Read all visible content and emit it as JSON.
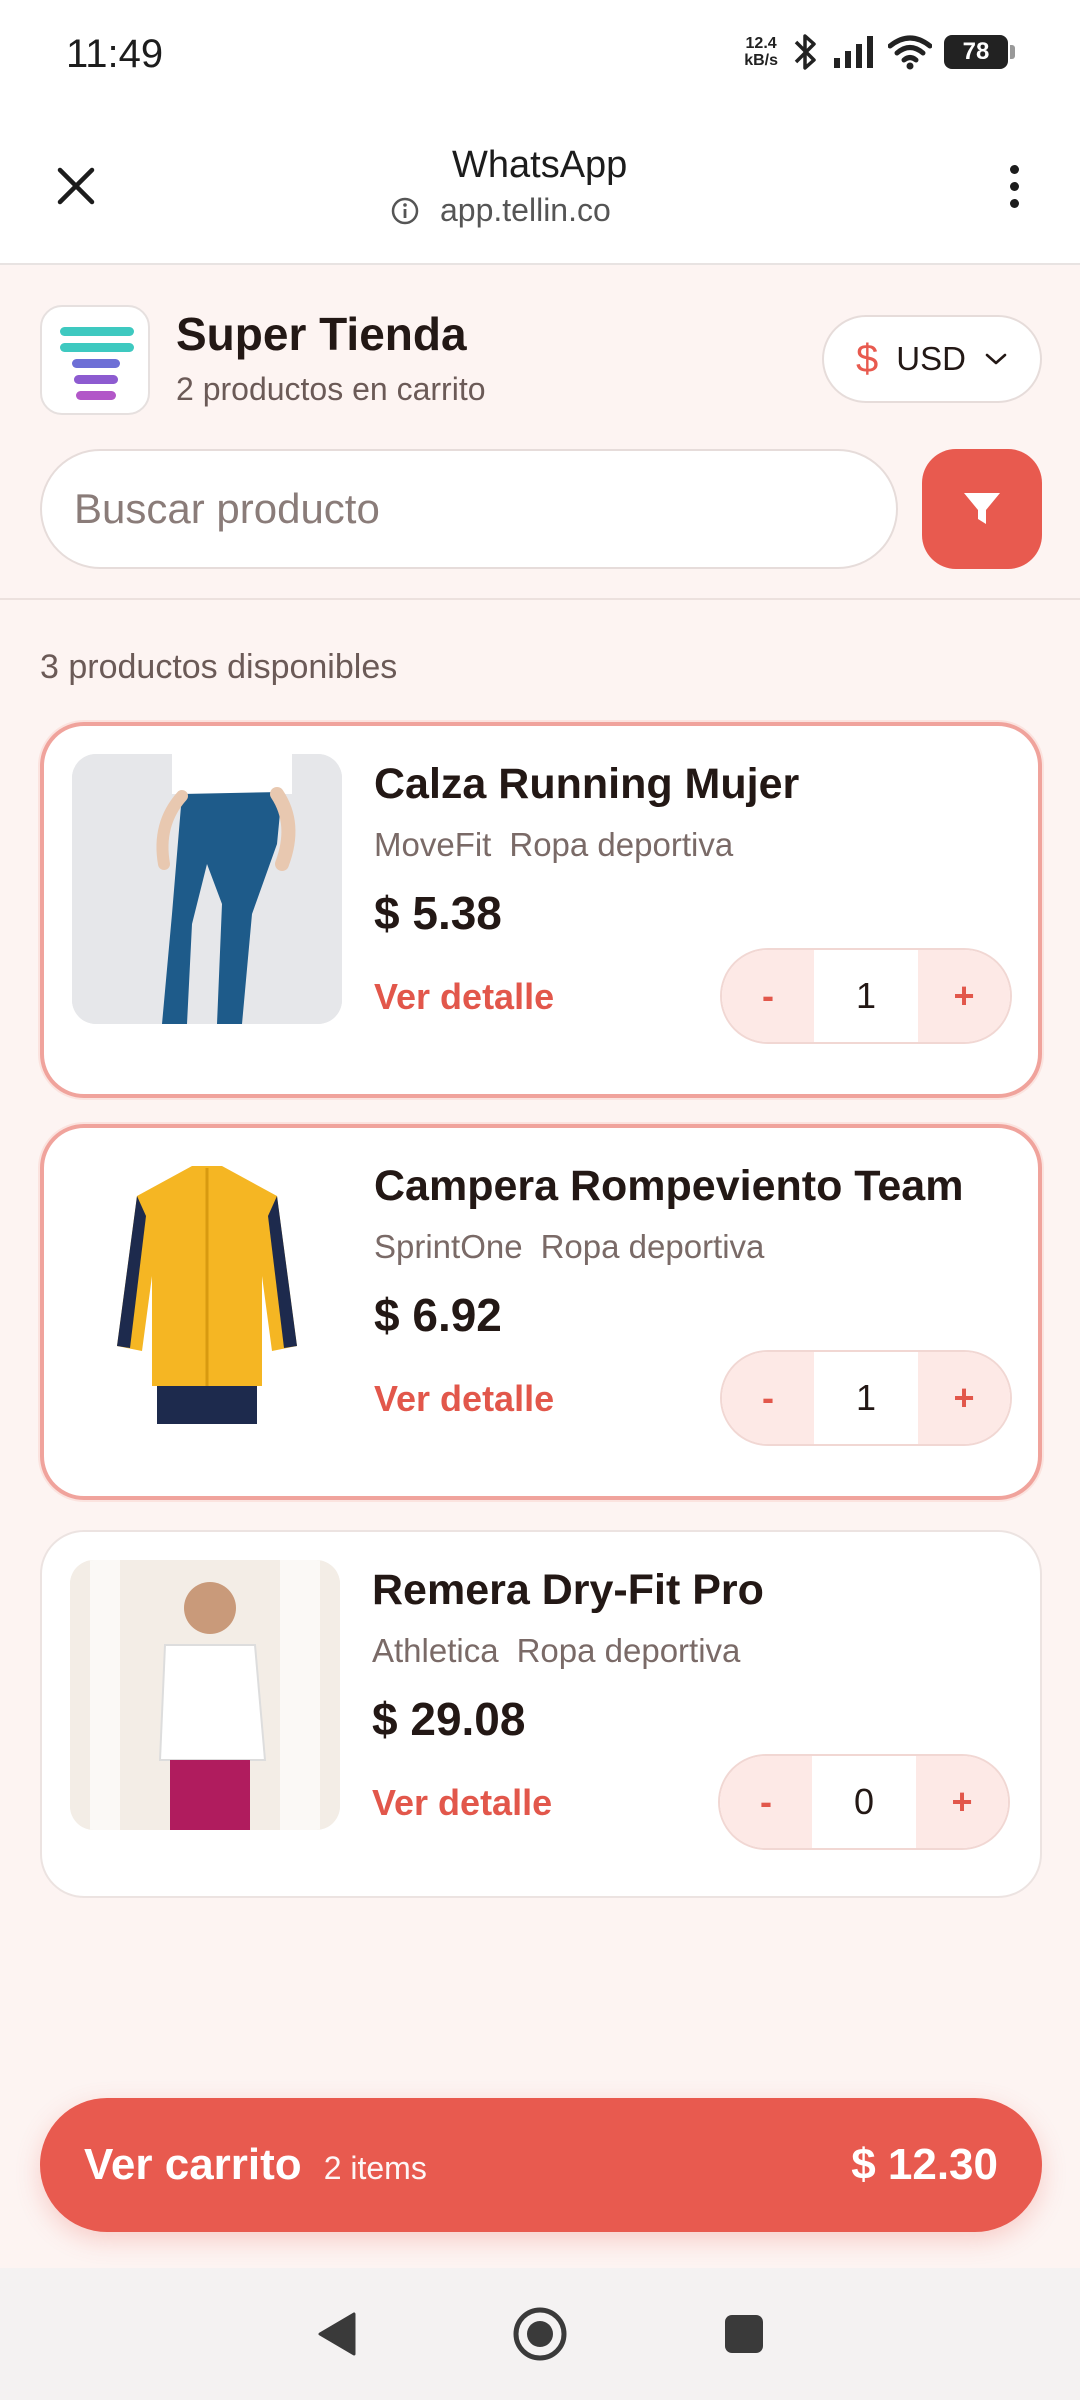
{
  "status_bar": {
    "time": "11:49",
    "net_speed_value": "12.4",
    "net_speed_unit": "kB/s",
    "battery": "78",
    "icons": [
      "bluetooth-icon",
      "signal-icon",
      "wifi-icon",
      "battery-icon"
    ]
  },
  "browser": {
    "title": "WhatsApp",
    "url": "app.tellin.co",
    "icons": [
      "close-icon",
      "info-icon",
      "more-vert-icon"
    ]
  },
  "store": {
    "name": "Super Tienda",
    "subtitle": "2 productos en carrito",
    "currency_symbol": "$",
    "currency": "USD",
    "search_placeholder": "Buscar producto",
    "available_text": "3 productos disponibles",
    "accent_color": "#e85a4f"
  },
  "products": [
    {
      "name": "Calza Running Mujer",
      "brand": "MoveFit",
      "category": "Ropa deportiva",
      "price": "$ 5.38",
      "detail_label": "Ver detalle",
      "minus": "-",
      "qty": "1",
      "plus": "+",
      "selected": true
    },
    {
      "name": "Campera Rompeviento Team",
      "brand": "SprintOne",
      "category": "Ropa deportiva",
      "price": "$ 6.92",
      "detail_label": "Ver detalle",
      "minus": "-",
      "qty": "1",
      "plus": "+",
      "selected": true
    },
    {
      "name": "Remera Dry-Fit Pro",
      "brand": "Athletica",
      "category": "Ropa deportiva",
      "price": "$ 29.08",
      "detail_label": "Ver detalle",
      "minus": "-",
      "qty": "0",
      "plus": "+",
      "selected": false
    }
  ],
  "cart": {
    "label": "Ver carrito",
    "items": "2 items",
    "total": "$ 12.30"
  },
  "nav": {
    "icons": [
      "back-icon",
      "home-icon",
      "recents-icon"
    ]
  }
}
